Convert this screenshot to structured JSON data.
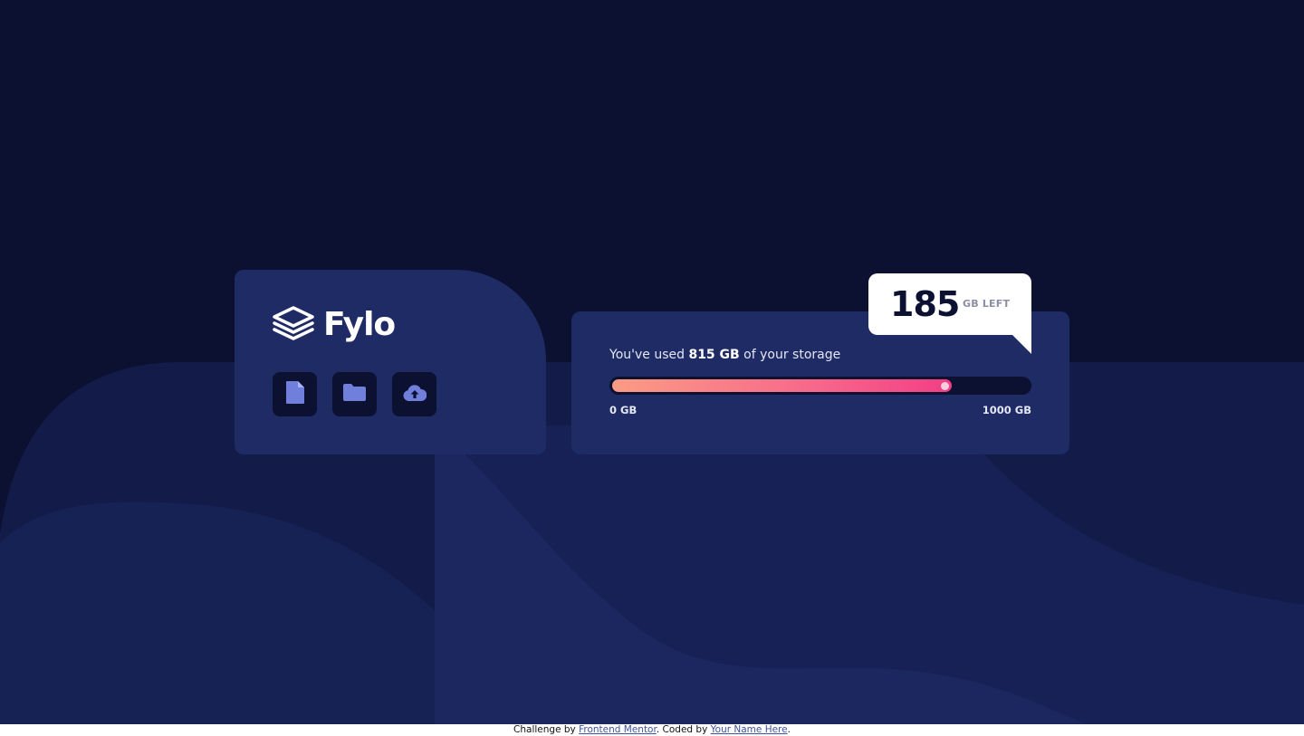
{
  "brand": {
    "name": "Fylo",
    "logo_icon": "layers-icon"
  },
  "toolbar": {
    "buttons": [
      {
        "icon": "document-icon"
      },
      {
        "icon": "folder-icon"
      },
      {
        "icon": "cloud-upload-icon"
      }
    ]
  },
  "storage": {
    "used_prefix": "You've used",
    "used_amount": "815 GB",
    "used_suffix": "of your storage",
    "used_fraction": 0.815,
    "scale_min": "0 GB",
    "scale_max": "1000 GB"
  },
  "callout": {
    "value": "185",
    "unit": "GB LEFT"
  },
  "attribution": {
    "prefix": "Challenge by",
    "link1": "Frontend Mentor",
    "middle": ". Coded by",
    "link2": "Your Name Here",
    "suffix": "."
  },
  "colors": {
    "background": "#0c1132",
    "card": "#1f2b65",
    "accent_start": "#fa9c84",
    "accent_end": "#f23e85",
    "icon": "#6f7fdb"
  }
}
